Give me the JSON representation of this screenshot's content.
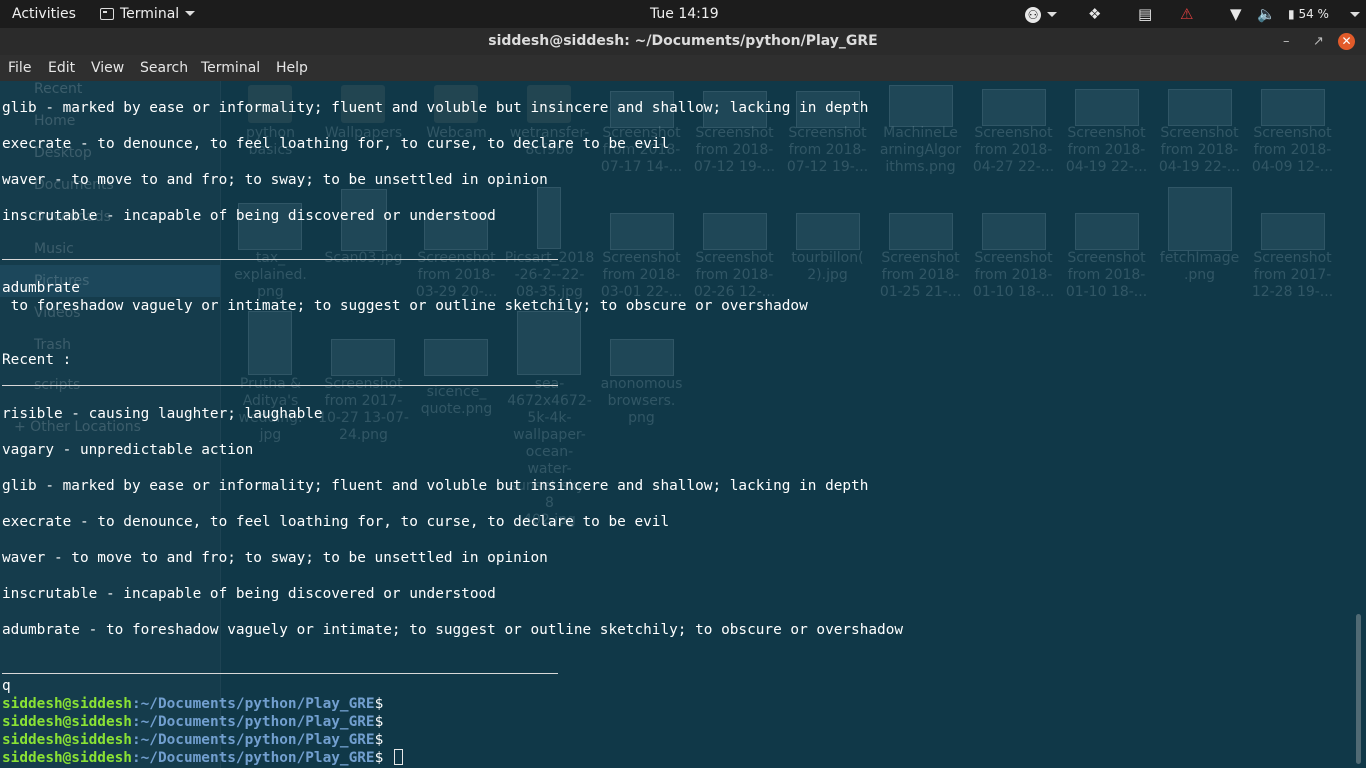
{
  "topbar": {
    "activities": "Activities",
    "app_name": "Terminal",
    "clock": "Tue 14:19",
    "battery": "54 %"
  },
  "window": {
    "title": "siddesh@siddesh: ~/Documents/python/Play_GRE"
  },
  "menu": [
    "File",
    "Edit",
    "View",
    "Search",
    "Terminal",
    "Help"
  ],
  "background_sidebar": [
    "Recent",
    "Home",
    "Desktop",
    "Documents",
    "Downloads",
    "Music",
    "Pictures",
    "Videos",
    "Trash",
    "scripts",
    "+ Other Locations"
  ],
  "background_files": [
    "python\nbasics",
    "Wallpapers",
    "Webcam",
    "wetransfer-\n8cf9b0",
    "Screenshot\nfrom 2018-\n07-17 14-...",
    "Screenshot\nfrom 2018-\n07-12 19-...",
    "Screenshot\nfrom 2018-\n07-12 19-...",
    "MachineLe\narningAlgor\nithms.png",
    "Screenshot\nfrom 2018-\n04-27 22-...",
    "Screenshot\nfrom 2018-\n04-19 22-...",
    "Screenshot\nfrom 2018-\n04-19 22-...",
    "Screenshot\nfrom 2018-\n04-09 12-...",
    "tax_\nexplained.\npng",
    "Scan03.jpg",
    "Screenshot\nfrom 2018-\n03-29 20-...",
    "Picsart_2018\n-26-2--22-\n08-35.jpg",
    "Screenshot\nfrom 2018-\n03-01 22-...",
    "Screenshot\nfrom 2018-\n02-26 12-...",
    "tourbillon(\n2).jpg",
    "Screenshot\nfrom 2018-\n01-25 21-...",
    "Screenshot\nfrom 2018-\n01-10 18-...",
    "Screenshot\nfrom 2018-\n01-10 18-...",
    "fetchImage\n.png",
    "Screenshot\nfrom 2017-\n12-28 19-...",
    "Prutha &\nAditya's\nwedding.\njpg",
    "Screenshot\nfrom 2017-\n10-27 13-07-\n24.png",
    "sicence_\nquote.png",
    "sea-\n4672x4672-\n5k-4k-\nwallpaper-\nocean-\nwater-\nsunset-sky-\n8\n402.jpg",
    "anonomous\nbrowsers.\npng"
  ],
  "terminal": {
    "lines": [
      "glib - marked by ease or informality; fluent and voluble but insincere and shallow; lacking in depth",
      "execrate - to denounce, to feel loathing for, to curse, to declare to be evil",
      "waver - to move to and fro; to sway; to be unsettled in opinion",
      "inscrutable - incapable of being discovered or understood",
      "adumbrate",
      " to foreshadow vaguely or intimate; to suggest or outline sketchily; to obscure or overshadow",
      "Recent :",
      "risible - causing laughter; laughable",
      "vagary - unpredictable action",
      "glib - marked by ease or informality; fluent and voluble but insincere and shallow; lacking in depth",
      "execrate - to denounce, to feel loathing for, to curse, to declare to be evil",
      "waver - to move to and fro; to sway; to be unsettled in opinion",
      "inscrutable - incapable of being discovered or understood",
      "adumbrate - to foreshadow vaguely or intimate; to suggest or outline sketchily; to obscure or overshadow",
      "q"
    ],
    "prompt_user": "siddesh@siddesh",
    "prompt_path": ":~/Documents/python/Play_GRE",
    "prompt_symbol": "$"
  }
}
